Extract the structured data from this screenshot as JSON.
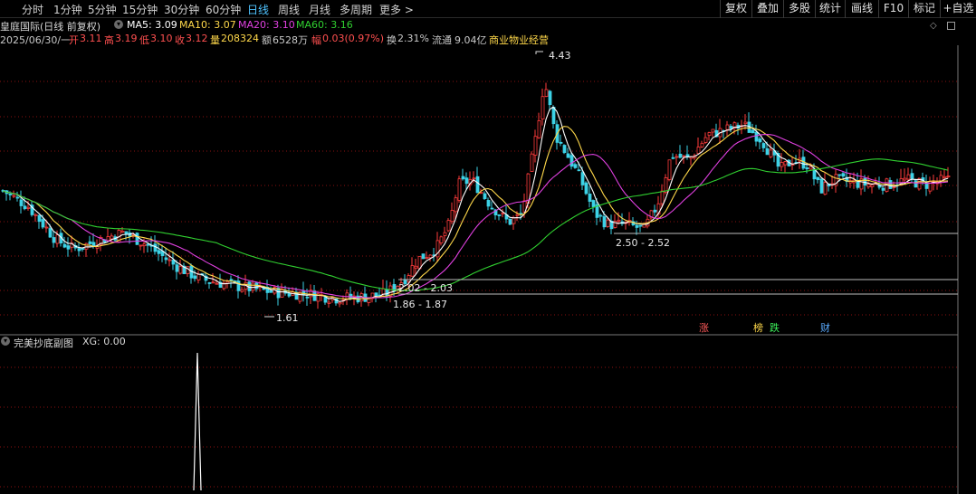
{
  "toolbar": {
    "tabs": [
      "分时",
      "1分钟",
      "5分钟",
      "15分钟",
      "30分钟",
      "60分钟",
      "日线",
      "周线",
      "月线",
      "多周期",
      "更多 >"
    ],
    "active_tab": "日线",
    "buttons": [
      "复权",
      "叠加",
      "多股",
      "统计",
      "画线",
      "F10",
      "标记",
      "+自选"
    ]
  },
  "header": {
    "stock_name": "皇庭国际(日线 前复权)",
    "ma5": "MA5: 3.09",
    "ma10": "MA10: 3.07",
    "ma20": "MA20: 3.10",
    "ma60": "MA60: 3.16"
  },
  "quote": {
    "date": "2025/06/30/一",
    "open_label": "开",
    "open": "3.11",
    "high_label": "高",
    "high": "3.19",
    "low_label": "低",
    "low": "3.10",
    "close_label": "收",
    "close": "3.12",
    "volume_label": "量",
    "volume": "208324",
    "amount_label": "额",
    "amount": "6528万",
    "change_label": "幅",
    "change": "0.03(0.97%)",
    "turnover_label": "换",
    "turnover": "2.31%",
    "float_label": "流通",
    "float_cap": "9.04亿",
    "industry": "商业物业经营"
  },
  "annotations": {
    "peak_high": "4.43",
    "low_mark": "1.61",
    "zone_a": "2.50 - 2.52",
    "zone_b": "2.02 - 2.03",
    "zone_c": "1.86 - 1.87"
  },
  "event_markers": [
    {
      "label": "涨",
      "color": "#ff5a5a"
    },
    {
      "label": "榜",
      "color": "#ffd84a"
    },
    {
      "label": "跌",
      "color": "#3cf05a"
    },
    {
      "label": "财",
      "color": "#5aaaff"
    }
  ],
  "sub_indicator": {
    "name": "完美抄底副图",
    "value": "XG: 0.00"
  },
  "colors": {
    "up": "#ff3c3c",
    "down": "#3cd2e6",
    "ma5": "#ffffff",
    "ma10": "#ffd84a",
    "ma20": "#e040e0",
    "ma60": "#30d030",
    "grid": "#8a1010",
    "accent": "#4fc3ff"
  },
  "chart_data": {
    "type": "candlestick",
    "series": [
      {
        "name": "MA5",
        "value": 3.09
      },
      {
        "name": "MA10",
        "value": 3.07
      },
      {
        "name": "MA20",
        "value": 3.1
      },
      {
        "name": "MA60",
        "value": 3.16
      }
    ],
    "close_path": [
      2.95,
      2.7,
      2.5,
      2.35,
      2.45,
      2.5,
      2.3,
      2.15,
      2.05,
      2.0,
      1.95,
      1.92,
      1.88,
      1.85,
      1.87,
      1.88,
      1.95,
      2.3,
      2.35,
      3.0,
      3.2,
      2.8,
      2.7,
      3.5,
      4.1,
      3.3,
      3.0,
      2.55,
      2.55,
      2.7,
      3.4,
      3.6,
      3.8,
      3.5,
      3.2,
      3.3,
      3.15,
      3.1,
      3.12
    ],
    "labels": [
      "4.43",
      "2.50 - 2.52",
      "2.02 - 2.03",
      "1.86 - 1.87",
      "1.61"
    ],
    "sub_signal": "XG spike"
  }
}
